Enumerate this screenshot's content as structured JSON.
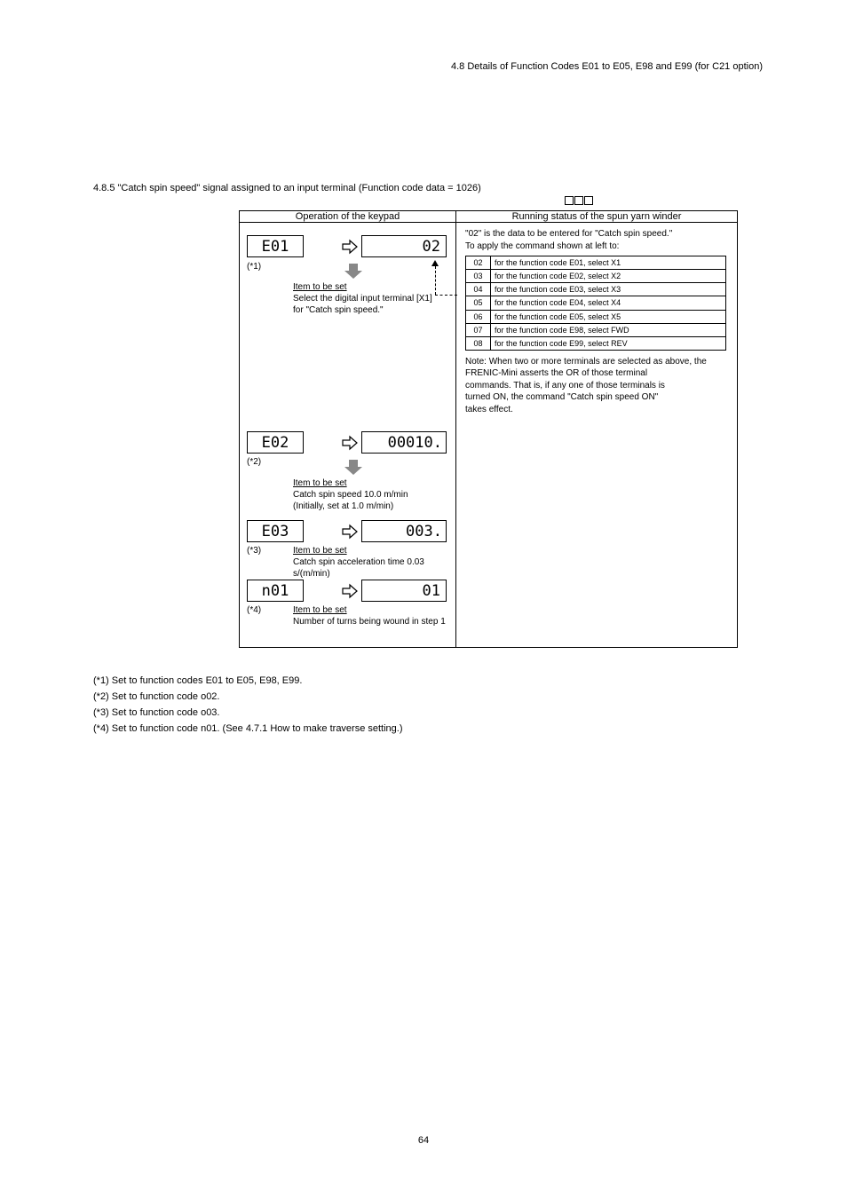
{
  "header": "4.8  Details of Function Codes E01 to E05, E98 and E99 (for C21 option)",
  "chapter": "4.8.5  \"Catch spin speed\" signal assigned to an input terminal (Function code data = 1026)",
  "squares_label": "□□□",
  "table": {
    "left_header": "Operation of the keypad",
    "right_header": "Running status of the spun yarn winder",
    "rows": [
      {
        "code": "E01",
        "val": "02",
        "cap_title": "Item to be set",
        "cap_body": "Select the digital input terminal [X1] for \"Catch spin speed.\""
      },
      {
        "code": "E02",
        "val": "00010",
        "cap_title": "Item to be set",
        "cap_body": "Catch spin speed 10.0 m/min\n(Initially, set at 1.0 m/min)"
      },
      {
        "code": "E03",
        "val": "003",
        "cap_title": "Item to be set",
        "cap_body": "Catch spin acceleration time 0.03 s/(m/min)"
      },
      {
        "code": "n01",
        "val": "01",
        "cap_title": "Item to be set",
        "cap_body": "Number of turns being wound in step 1"
      }
    ],
    "right_top": "\"02\" is the data to be entered for \"Catch spin speed.\"",
    "inner_header": [
      "02",
      "X1"
    ],
    "inner_rows": [
      [
        "03",
        "X2"
      ],
      [
        "04",
        "X3"
      ],
      [
        "05",
        "X4"
      ],
      [
        "06",
        "X5"
      ],
      [
        "07",
        "FWD"
      ],
      [
        "08",
        "REV"
      ]
    ],
    "note": "Note: When two or more terminals are selected as above, the",
    "note2": "       asserts the OR of those terminal\ncommands. That is, if any one of those terminals is\nturned ON, the command \"Catch spin speed ON\"\ntakes effect."
  },
  "footnotes": [
    "(*1) Set to function codes E01 to E05, E98, E99.",
    "(*2) Set to function code o02.",
    "(*3) Set to function code o03.",
    "(*4) Set to function code n01. (See 4.7.1 How to make traverse setting.)"
  ],
  "pagenum": "64"
}
